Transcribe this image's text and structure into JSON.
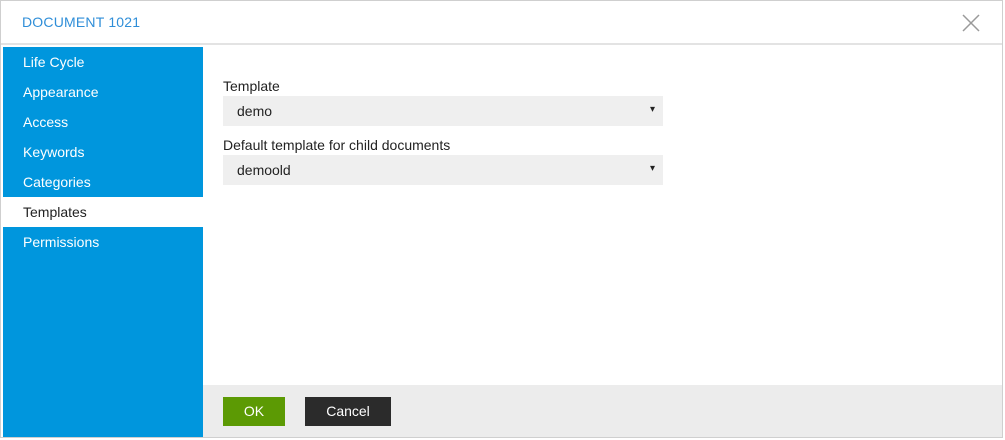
{
  "dialog": {
    "title": "DOCUMENT 1021",
    "close_icon": "close-icon"
  },
  "sidebar": {
    "items": [
      {
        "label": "Life Cycle",
        "active": false
      },
      {
        "label": "Appearance",
        "active": false
      },
      {
        "label": "Access",
        "active": false
      },
      {
        "label": "Keywords",
        "active": false
      },
      {
        "label": "Categories",
        "active": false
      },
      {
        "label": "Templates",
        "active": true
      },
      {
        "label": "Permissions",
        "active": false
      }
    ]
  },
  "form": {
    "template_label": "Template",
    "template_value": "demo",
    "child_template_label": "Default template for child documents",
    "child_template_value": "demoold",
    "dropdown_icon": "▾"
  },
  "footer": {
    "ok_label": "OK",
    "cancel_label": "Cancel"
  },
  "colors": {
    "accent": "#0096dd",
    "title": "#2f8ed8",
    "ok_button": "#5c9a04",
    "cancel_button": "#2b2b2b"
  }
}
